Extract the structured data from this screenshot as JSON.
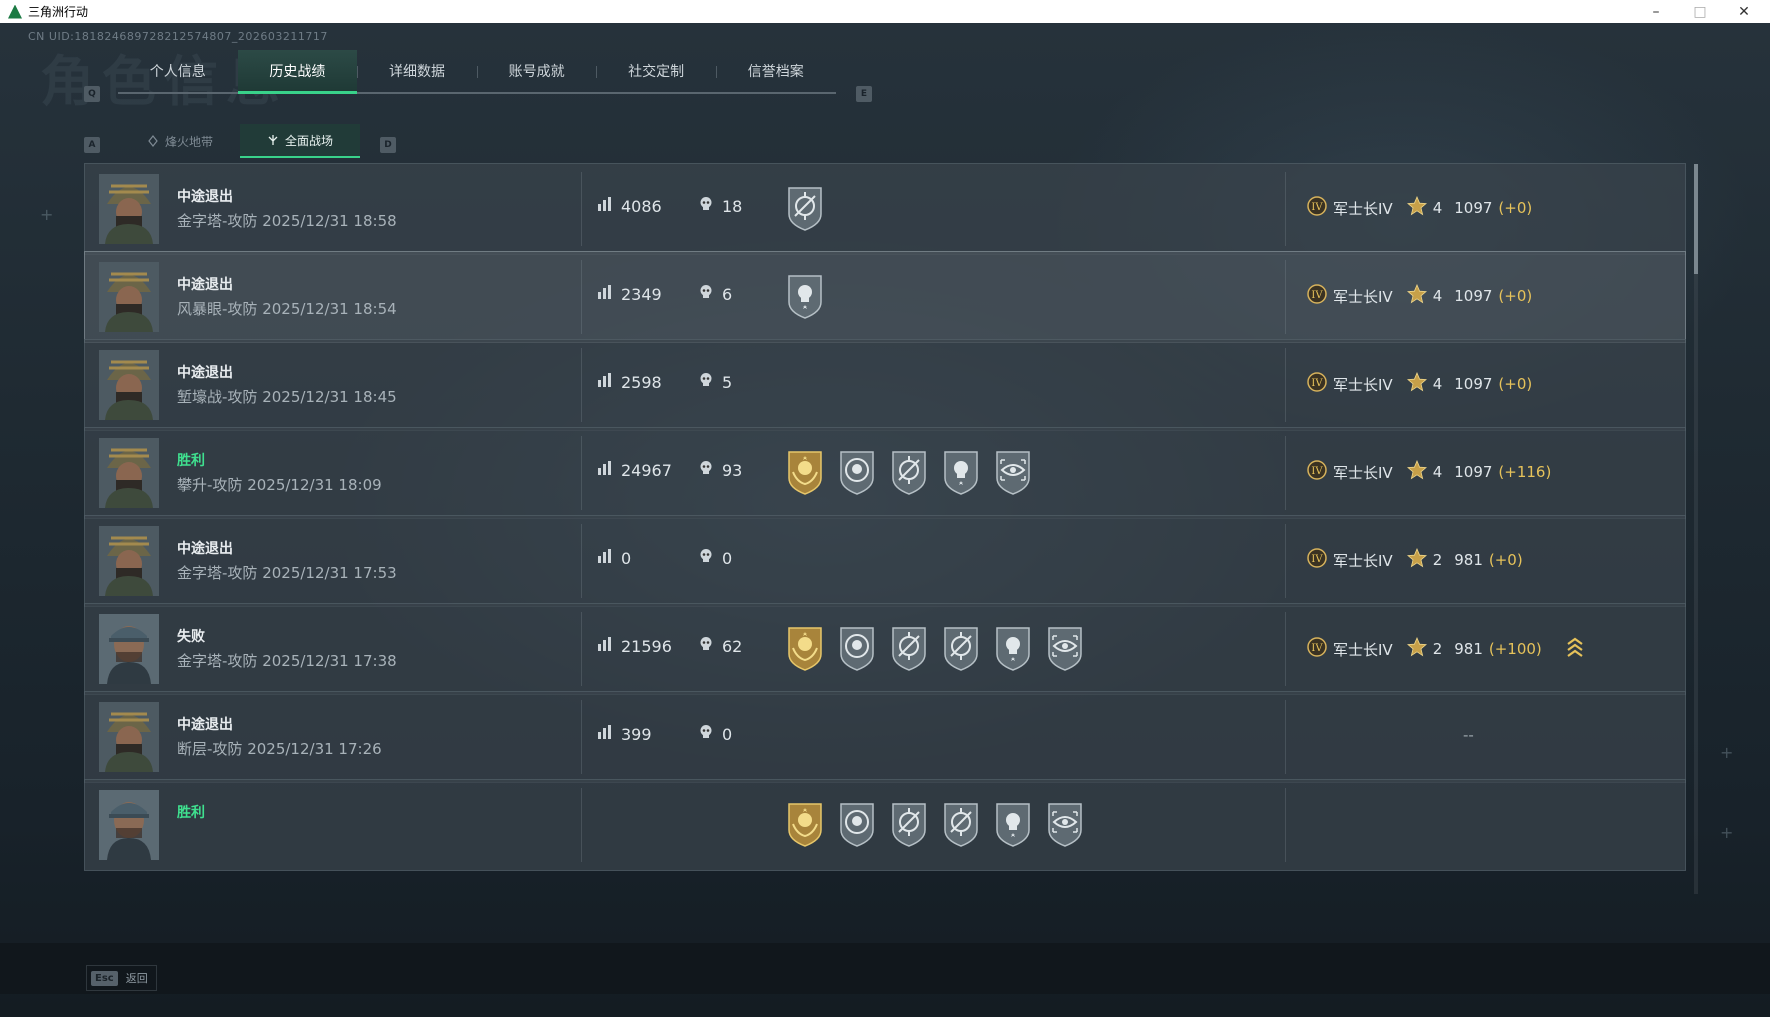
{
  "window": {
    "title": "三角洲行动",
    "min": "–",
    "max": "□",
    "close": "✕"
  },
  "uid": "CN UID:18182468972821257480​7_20260321171​7",
  "bg_title": "角色信息",
  "keys": {
    "prev_tab": "Q",
    "next_tab": "E",
    "prev_sub": "A",
    "next_sub": "D"
  },
  "tabs": [
    "个人信息",
    "历史战绩",
    "详细数据",
    "账号成就",
    "社交定制",
    "信誉档案"
  ],
  "active_tab": 1,
  "subtabs": [
    "烽火地带",
    "全面战场"
  ],
  "active_subtab": 1,
  "matches": [
    {
      "result": "中途退出",
      "map": "金字塔-攻防",
      "time": "2025/12/31 18:58",
      "score": "4086",
      "kills": "18",
      "medals": [
        "crosshair"
      ],
      "rank": "军士长IV",
      "stars": "4",
      "points": "1097",
      "delta": "(+0)"
    },
    {
      "result": "中途退出",
      "map": "风暴眼-攻防",
      "time": "2025/12/31 18:54",
      "score": "2349",
      "kills": "6",
      "medals": [
        "skull-star"
      ],
      "rank": "军士长IV",
      "stars": "4",
      "points": "1097",
      "delta": "(+0)"
    },
    {
      "result": "中途退出",
      "map": "堑壕战-攻防",
      "time": "2025/12/31 18:45",
      "score": "2598",
      "kills": "5",
      "medals": [],
      "rank": "军士长IV",
      "stars": "4",
      "points": "1097",
      "delta": "(+0)"
    },
    {
      "result": "胜利",
      "map": "攀升-攻防",
      "time": "2025/12/31 18:09",
      "score": "24967",
      "kills": "93",
      "medals": [
        "gold-wreath",
        "skull-ring",
        "crosshair",
        "skull-star",
        "eye-target"
      ],
      "rank": "军士长IV",
      "stars": "4",
      "points": "1097",
      "delta": "(+116)"
    },
    {
      "result": "中途退出",
      "map": "金字塔-攻防",
      "time": "2025/12/31 17:53",
      "score": "0",
      "kills": "0",
      "medals": [],
      "rank": "军士长IV",
      "stars": "2",
      "points": "981",
      "delta": "(+0)"
    },
    {
      "result": "失败",
      "map": "金字塔-攻防",
      "time": "2025/12/31 17:38",
      "score": "21596",
      "kills": "62",
      "medals": [
        "gold-wreath",
        "skull-ring",
        "crosshair",
        "crosshair",
        "skull-star",
        "eye-target"
      ],
      "rank": "军士长IV",
      "stars": "2",
      "points": "981",
      "delta": "(+100)"
    },
    {
      "result": "中途退出",
      "map": "断层-攻防",
      "time": "2025/12/31 17:26",
      "score": "399",
      "kills": "0",
      "medals": [],
      "rank": "",
      "stars": "",
      "points": "",
      "delta": "",
      "empty_rank": "--"
    },
    {
      "result": "胜利",
      "map": "",
      "time": "",
      "score": "",
      "kills": "",
      "medals": [
        "gold-wreath",
        "skull-ring",
        "crosshair",
        "crosshair",
        "skull-star",
        "eye-target"
      ],
      "rank": "",
      "stars": "",
      "points": "",
      "delta": ""
    }
  ],
  "esc": {
    "key": "Esc",
    "label": "返回"
  },
  "colors": {
    "win": "#3fe08f",
    "accent": "#39d28a",
    "delta": "#e6c25a"
  }
}
